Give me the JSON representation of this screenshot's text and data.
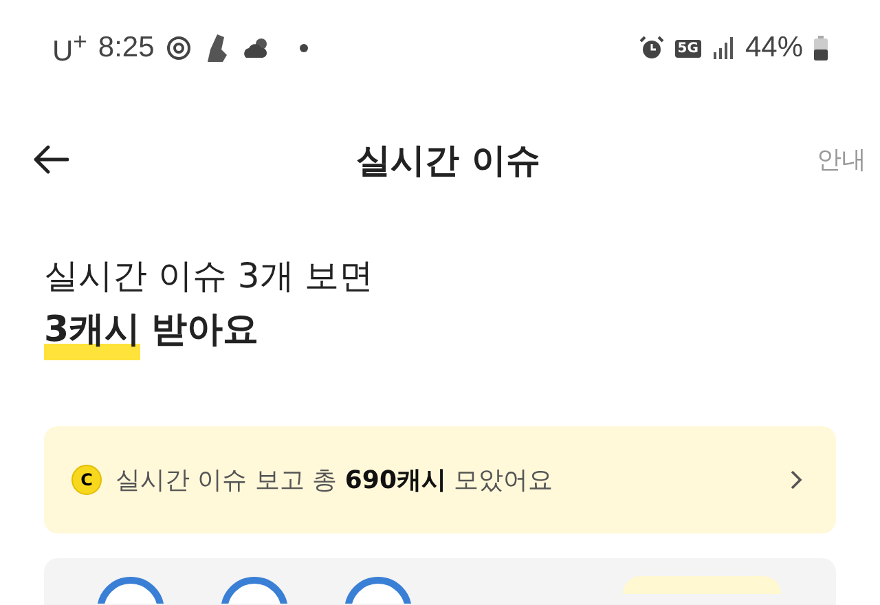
{
  "status_bar": {
    "carrier": "U$^{+}$",
    "time": "8:25",
    "network": "5G",
    "battery": "44%"
  },
  "header": {
    "title": "실시간 이슈",
    "action": "안내"
  },
  "intro": {
    "line_1": "실시간 이슈 3개 보면",
    "highlight": "3캐시",
    "line_2_rest": "받아요"
  },
  "banner": {
    "coin": "C",
    "text": "실시간 이슈 보고 총 **690캐시** 모았어요"
  }
}
